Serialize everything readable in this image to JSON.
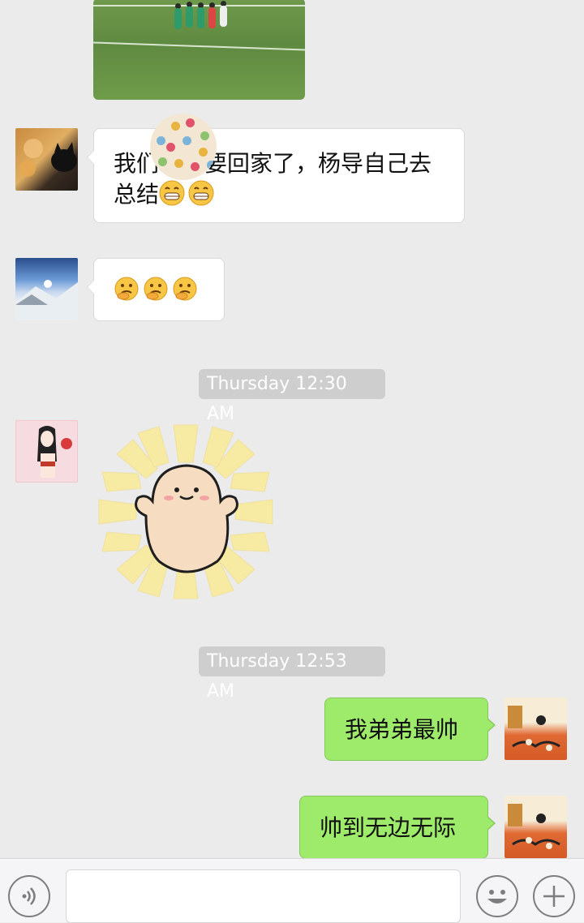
{
  "messages": [
    {
      "side": "left",
      "text": "我们马上要回家了，杨导自己去总结"
    },
    {
      "side": "left",
      "text": ""
    },
    {
      "side": "right",
      "text": "我弟弟最帅"
    },
    {
      "side": "right",
      "text": "帅到无边无际"
    }
  ],
  "timestamps": [
    "Thursday 12:30 AM",
    "Thursday 12:53 AM"
  ],
  "input": {
    "placeholder": ""
  },
  "colors": {
    "background": "#ebebeb",
    "sent_bubble": "#9eea6a",
    "received_bubble": "#ffffff",
    "timestamp_bg": "#cecece"
  },
  "icons": [
    "voice-icon",
    "emoji-icon",
    "plus-icon",
    "grin-emoji-icon",
    "thinking-emoji-icon"
  ]
}
